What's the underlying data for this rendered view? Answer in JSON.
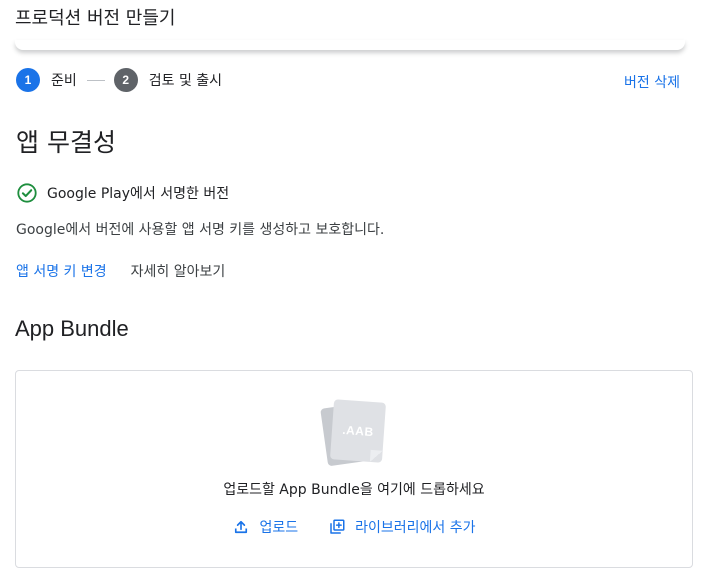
{
  "header": {
    "title": "프로덕션 버전 만들기"
  },
  "stepper": {
    "steps": [
      {
        "number": "1",
        "label": "준비",
        "state": "active"
      },
      {
        "number": "2",
        "label": "검토 및 출시",
        "state": "inactive"
      }
    ]
  },
  "actions": {
    "delete_release": "버전 삭제"
  },
  "app_integrity": {
    "title": "앱 무결성",
    "status_icon": "check-circle-icon",
    "status": "Google Play에서 서명한 버전",
    "description": "Google에서 버전에 사용할 앱 서명 키를 생성하고 보호합니다.",
    "change_key_link": "앱 서명 키 변경",
    "learn_more_link": "자세히 알아보기"
  },
  "app_bundle": {
    "title": "App Bundle",
    "file_icon_label": ".AAB",
    "drop_prompt": "업로드할 App Bundle을 여기에 드롭하세요",
    "upload_button": "업로드",
    "library_button": "라이브러리에서 추가"
  },
  "colors": {
    "accent": "#1a73e8",
    "success": "#1e8e3e",
    "inactive_step": "#5f6368",
    "text_primary": "#202124"
  }
}
